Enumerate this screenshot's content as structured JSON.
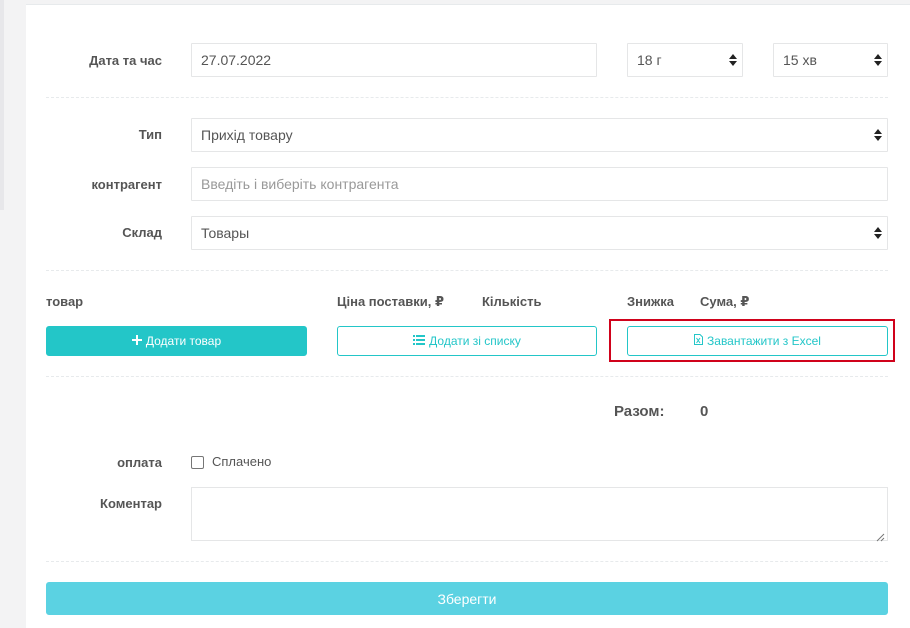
{
  "form": {
    "datetime": {
      "label": "Дата та час",
      "date_value": "27.07.2022",
      "hour_value": "18 г",
      "minute_value": "15 хв"
    },
    "type": {
      "label": "Тип",
      "value": "Прихід товару"
    },
    "counterparty": {
      "label": "контрагент",
      "placeholder": "Введіть і виберіть контрагента"
    },
    "warehouse": {
      "label": "Склад",
      "value": "Товары"
    }
  },
  "items_table": {
    "headers": {
      "product": "товар",
      "price": "Ціна поставки, ₽",
      "quantity": "Кількість",
      "discount": "Знижка",
      "sum": "Сума, ₽"
    },
    "add_product_button": "Додати товар",
    "add_from_list_button": "Додати зі списку",
    "import_excel_button": "Завантажити з Excel"
  },
  "total": {
    "label": "Разом:",
    "value": "0"
  },
  "payment": {
    "label": "оплата",
    "checkbox_label": "Сплачено",
    "checked": false
  },
  "comment": {
    "label": "Коментар",
    "value": ""
  },
  "save_button": "Зберегти",
  "colors": {
    "accent": "#23c6c8",
    "save": "#5bd2e2",
    "highlight": "#d0021b"
  }
}
